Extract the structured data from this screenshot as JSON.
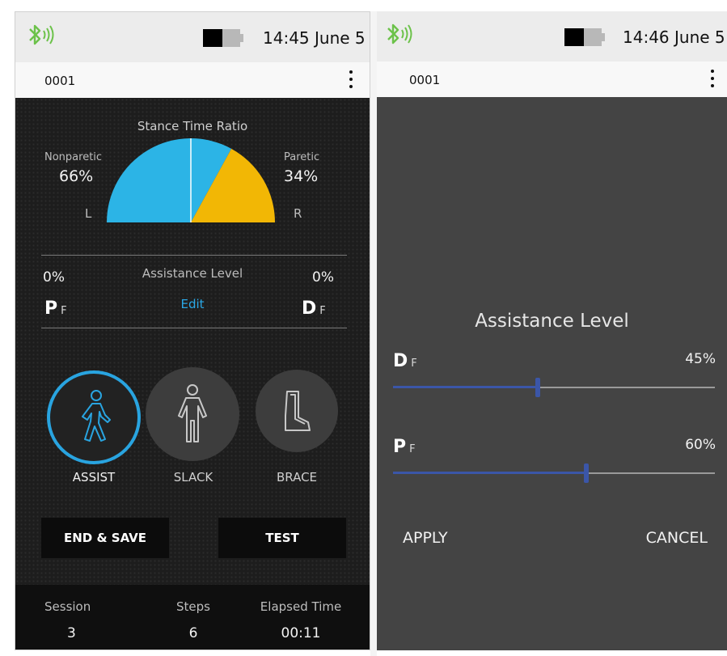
{
  "left": {
    "clock": "14:45 June 5",
    "device_id": "0001",
    "stance": {
      "title": "Stance Time Ratio",
      "nonparetic_label": "Nonparetic",
      "nonparetic_pct": "66%",
      "paretic_label": "Paretic",
      "paretic_pct": "34%",
      "left_side": "L",
      "right_side": "R",
      "nonparetic_fraction": 0.66,
      "paretic_fraction": 0.34
    },
    "assistance": {
      "title": "Assistance Level",
      "pf_value": "0%",
      "df_value": "0%",
      "pf_letter": "P",
      "pf_sub": "F",
      "df_letter": "D",
      "df_sub": "F",
      "edit": "Edit"
    },
    "modes": [
      {
        "label": "ASSIST",
        "icon": "walking-person-icon",
        "active": true
      },
      {
        "label": "SLACK",
        "icon": "standing-person-icon",
        "active": false
      },
      {
        "label": "BRACE",
        "icon": "boot-brace-icon",
        "active": false
      }
    ],
    "buttons": {
      "end_save": "END & SAVE",
      "test": "TEST"
    },
    "footer": {
      "session_label": "Session",
      "session_value": "3",
      "steps_label": "Steps",
      "steps_value": "6",
      "elapsed_label": "Elapsed Time",
      "elapsed_value": "00:11"
    }
  },
  "right": {
    "clock": "14:46 June 5",
    "device_id": "0001",
    "dialog": {
      "title": "Assistance Level",
      "df_letter": "D",
      "df_sub": "F",
      "df_value": "45%",
      "df_level": 0.45,
      "pf_letter": "P",
      "pf_sub": "F",
      "pf_value": "60%",
      "pf_level": 0.6,
      "apply": "APPLY",
      "cancel": "CANCEL"
    }
  },
  "colors": {
    "bluetooth": "#6cc24a",
    "nonparetic": "#2cb4e6",
    "paretic": "#f2b705",
    "accent": "#29a4e0",
    "slider": "#3b56a8"
  }
}
